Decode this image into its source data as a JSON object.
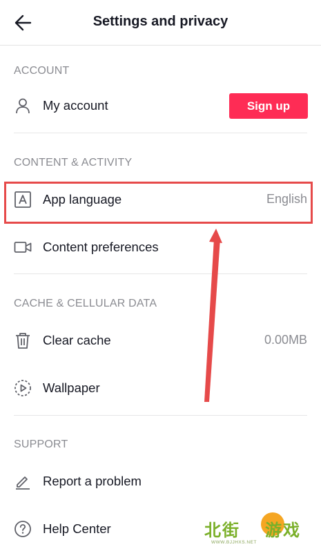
{
  "header": {
    "title": "Settings and privacy"
  },
  "sections": {
    "account": {
      "title": "ACCOUNT",
      "my_account": {
        "label": "My account",
        "signup_label": "Sign up"
      }
    },
    "content": {
      "title": "CONTENT & ACTIVITY",
      "app_language": {
        "label": "App language",
        "value": "English"
      },
      "content_preferences": {
        "label": "Content preferences"
      }
    },
    "cache": {
      "title": "CACHE & CELLULAR DATA",
      "clear_cache": {
        "label": "Clear cache",
        "value": "0.00MB"
      },
      "wallpaper": {
        "label": "Wallpaper"
      }
    },
    "support": {
      "title": "SUPPORT",
      "report": {
        "label": "Report a problem"
      },
      "help": {
        "label": "Help Center"
      }
    }
  },
  "colors": {
    "accent": "#fe2c55",
    "highlight": "#e64a4a"
  },
  "icons": {
    "back": "arrow-left-icon",
    "account": "person-icon",
    "language": "letter-a-icon",
    "content": "video-camera-icon",
    "cache": "trash-icon",
    "wallpaper": "play-circle-icon",
    "report": "pencil-icon",
    "help": "question-circle-icon"
  },
  "watermark": {
    "left_text": "北街",
    "right_text": "游戏",
    "url": "WWW.BJJHXS.NET"
  }
}
